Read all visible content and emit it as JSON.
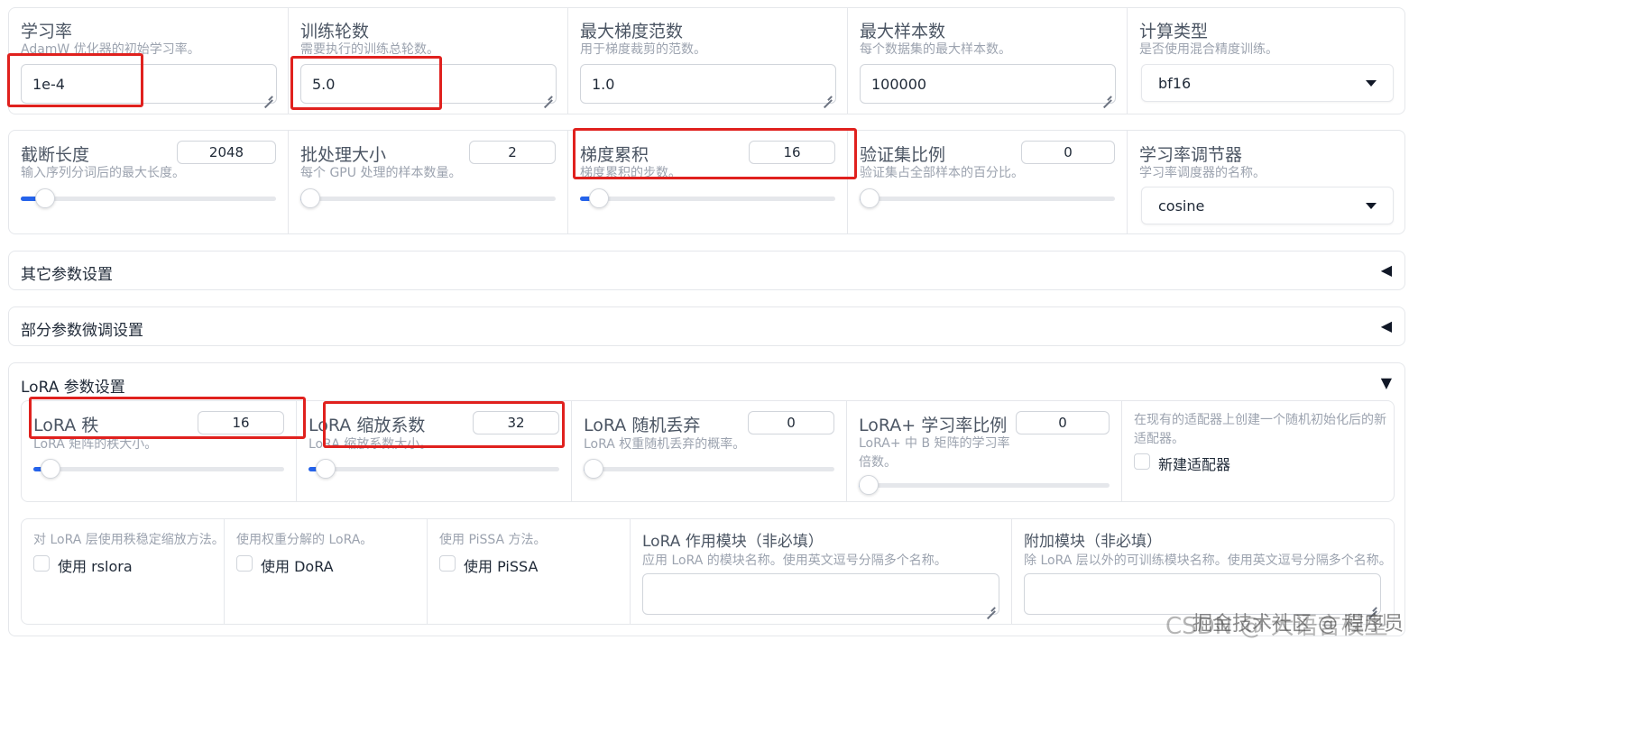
{
  "row1": [
    {
      "label": "学习率",
      "info": "AdamW 优化器的初始学习率。",
      "value": "1e-4",
      "type": "textarea"
    },
    {
      "label": "训练轮数",
      "info": "需要执行的训练总轮数。",
      "value": "5.0",
      "type": "textarea"
    },
    {
      "label": "最大梯度范数",
      "info": "用于梯度裁剪的范数。",
      "value": "1.0",
      "type": "textarea"
    },
    {
      "label": "最大样本数",
      "info": "每个数据集的最大样本数。",
      "value": "100000",
      "type": "textarea"
    },
    {
      "label": "计算类型",
      "info": "是否使用混合精度训练。",
      "value": "bf16",
      "type": "dropdown"
    }
  ],
  "row2": [
    {
      "label": "截断长度",
      "info": "输入序列分词后的最大长度。",
      "value": "2048",
      "fraction": 0.06
    },
    {
      "label": "批处理大小",
      "info": "每个 GPU 处理的样本数量。",
      "value": "2",
      "fraction": 0.0
    },
    {
      "label": "梯度累积",
      "info": "梯度累积的步数。",
      "value": "16",
      "fraction": 0.04
    },
    {
      "label": "验证集比例",
      "info": "验证集占全部样本的百分比。",
      "value": "0",
      "fraction": 0.0
    },
    {
      "label": "学习率调节器",
      "info": "学习率调度器的名称。",
      "value": "cosine",
      "type": "dropdown"
    }
  ],
  "accordions": {
    "other": {
      "title": "其它参数设置",
      "icon": "◀"
    },
    "freeze": {
      "title": "部分参数微调设置",
      "icon": "◀"
    },
    "lora": {
      "title": "LoRA 参数设置",
      "icon": "▼"
    }
  },
  "lora_row1": [
    {
      "label": "LoRA 秩",
      "info": "LoRA 矩阵的秩大小。",
      "value": "16",
      "fraction": 0.03
    },
    {
      "label": "LoRA 缩放系数",
      "info": "LoRA 缩放系数大小。",
      "value": "32",
      "fraction": 0.03
    },
    {
      "label": "LoRA 随机丢弃",
      "info": "LoRA 权重随机丢弃的概率。",
      "value": "0",
      "fraction": 0.0
    },
    {
      "label": "LoRA+ 学习率比例",
      "info": "LoRA+ 中 B 矩阵的学习率倍数。",
      "value": "0",
      "fraction": 0.0
    }
  ],
  "create_new_adapter": {
    "info": "在现有的适配器上创建一个随机初始化后的新适配器。",
    "label": "新建适配器"
  },
  "lora_row2_checks": [
    {
      "info": "对 LoRA 层使用秩稳定缩放方法。",
      "label": "使用 rslora"
    },
    {
      "info": "使用权重分解的 LoRA。",
      "label": "使用 DoRA"
    },
    {
      "info": "使用 PiSSA 方法。",
      "label": "使用 PiSSA"
    }
  ],
  "lora_target": {
    "label": "LoRA 作用模块（非必填）",
    "info": "应用 LoRA 的模块名称。使用英文逗号分隔多个名称。",
    "value": ""
  },
  "additional_target": {
    "label": "附加模块（非必填）",
    "info": "除 LoRA 层以外的可训练模块名称。使用英文逗号分隔多个名称。",
    "value": ""
  },
  "watermark": "CSDN @ 大语言模型",
  "watermark2": "掘金技术社区 @ 程序员",
  "colors": {
    "accent": "#2563eb",
    "highlight": "#e0211e",
    "border": "#e5e7eb"
  }
}
